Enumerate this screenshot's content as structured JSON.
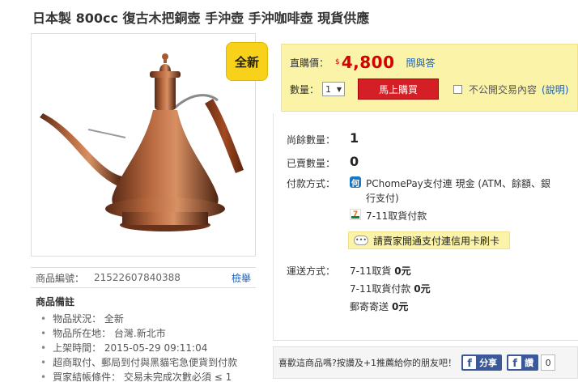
{
  "title": "日本製 800cc 復古木把銅壺 手沖壺 手沖咖啡壺 現貨供應",
  "badge": "全新",
  "product": {
    "code_label": "商品編號：",
    "code_value": "21522607840388",
    "report_label": "檢舉"
  },
  "notes": {
    "heading": "商品備註",
    "items": [
      "物品狀況： 全新",
      "物品所在地： 台灣.新北市",
      "上架時間： 2015-05-29 09:11:04",
      "超商取付、郵局到付與黑貓宅急便貨到付款",
      "買家結帳條件： 交易未完成次數必須 ≤ 1"
    ]
  },
  "buy": {
    "price_label": "直購價：",
    "currency": "$",
    "price": "4,800",
    "qa_label": "問與答",
    "qty_label": "數量：",
    "qty_value": "1",
    "buy_button": "馬上購買",
    "private_label": "不公開交易內容",
    "explain_label": "(說明)"
  },
  "stock": {
    "remaining_label": "尚餘數量：",
    "remaining_value": "1",
    "sold_label": "已賣數量：",
    "sold_value": "0"
  },
  "payment": {
    "label": "付款方式：",
    "pchome_icon": "何",
    "pchome_text": "PChomePay支付連 現金 (ATM、餘額、銀行支付)",
    "seven_text": "7-11取貨付款",
    "notice_icon": "•••",
    "notice_text": "請賣家開通支付連信用卡刷卡"
  },
  "shipping": {
    "label": "運送方式：",
    "lines": [
      {
        "name": "7-11取貨",
        "amount": "0元"
      },
      {
        "name": "7-11取貨付款",
        "amount": "0元"
      },
      {
        "name": "郵寄寄送",
        "amount": "0元"
      }
    ]
  },
  "share": {
    "text": "喜歡這商品嗎?按讚及+1推薦給你的朋友吧！",
    "fb_share": "分享",
    "fb_like": "讚",
    "like_count": "0"
  },
  "colors": {
    "price": "#d40000",
    "buy_button": "#d41f27",
    "buy_box": "#fbf3a8",
    "badge": "#f8d21a",
    "facebook": "#3b5998",
    "link": "#1a5fb4"
  }
}
